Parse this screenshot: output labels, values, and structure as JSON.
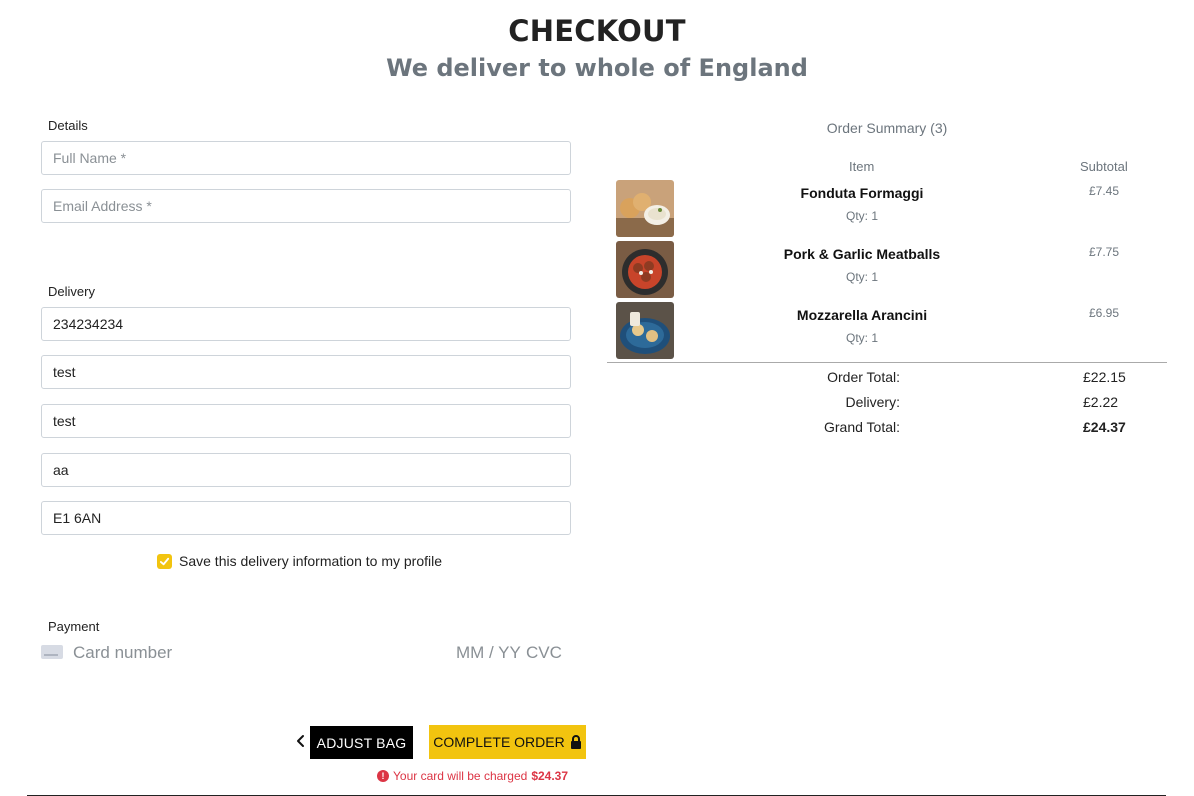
{
  "header": {
    "title": "CHECKOUT",
    "subtitle": "We deliver to whole of England"
  },
  "details": {
    "label": "Details",
    "full_name": {
      "value": "",
      "placeholder": "Full Name *"
    },
    "email": {
      "value": "",
      "placeholder": "Email Address *"
    }
  },
  "delivery": {
    "label": "Delivery",
    "phone": {
      "value": "234234234"
    },
    "address_line_1": {
      "value": "test"
    },
    "address_line_2": {
      "value": "test"
    },
    "town": {
      "value": "aa"
    },
    "postcode": {
      "value": "E1 6AN"
    },
    "save_label": "Save this delivery information to my profile",
    "save_checked": true
  },
  "payment": {
    "label": "Payment",
    "card_number_placeholder": "Card number",
    "expiry_placeholder": "MM / YY",
    "cvc_placeholder": "CVC"
  },
  "actions": {
    "adjust_bag": "ADJUST BAG",
    "complete_order": "COMPLETE ORDER",
    "charge_text": "Your card will be charged",
    "charge_amount": "$24.37"
  },
  "summary": {
    "title": "Order Summary (3)",
    "col_item": "Item",
    "col_subtotal": "Subtotal",
    "items": [
      {
        "name": "Fonduta Formaggi",
        "qty": "Qty: 1",
        "price": "£7.45"
      },
      {
        "name": "Pork & Garlic Meatballs",
        "qty": "Qty: 1",
        "price": "£7.75"
      },
      {
        "name": "Mozzarella Arancini",
        "qty": "Qty: 1",
        "price": "£6.95"
      }
    ],
    "order_total_label": "Order Total:",
    "order_total": "£22.15",
    "delivery_label": "Delivery:",
    "delivery": "£2.22",
    "grand_total_label": "Grand Total:",
    "grand_total": "£24.37"
  },
  "colors": {
    "accent": "#f2c40f",
    "error": "#dc3545",
    "muted": "#6c757d"
  }
}
